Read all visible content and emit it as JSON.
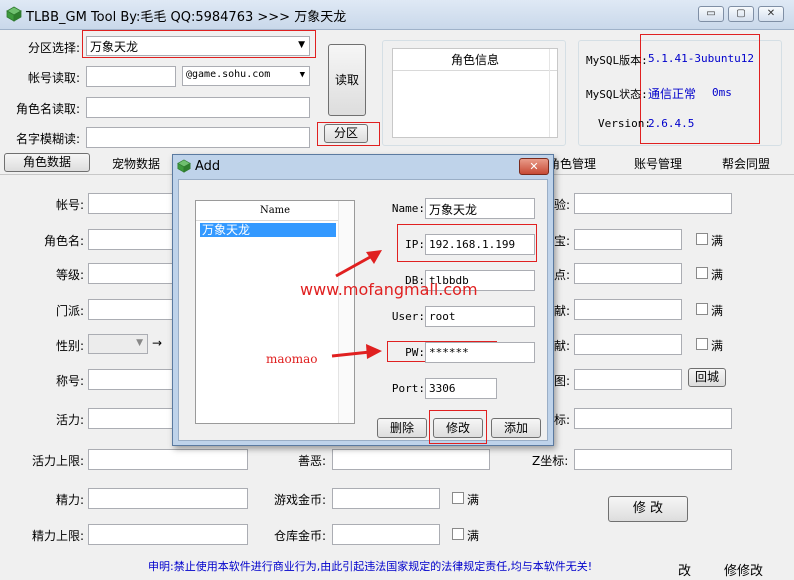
{
  "window": {
    "title": "TLBB_GM Tool By:毛毛 QQ:5984763 >>> 万象天龙",
    "minimize": "▭",
    "restore": "▢",
    "close": "✕"
  },
  "form": {
    "partition_label": "分区选择:",
    "partition_value": "万象天龙",
    "account_read_label": "帐号读取:",
    "account_read_value": "",
    "domain_value": "@game.sohu.com",
    "role_name_read_label": "角色名读取:",
    "fuzzy_name_label": "名字模糊读:",
    "read_button": "读取",
    "partition_button": "分区"
  },
  "role_info": {
    "header": "角色信息"
  },
  "mysql": {
    "version_label": "MySQL版本:",
    "version_value": "5.1.41-3ubuntu12",
    "status_label": "MySQL状态:",
    "status_value": "通信正常",
    "status_time": "0ms",
    "tool_version_label": "Version:",
    "tool_version_value": "2.6.4.5",
    "status_color": "#0000cc"
  },
  "tabs": {
    "role_data": "角色数据",
    "pet_data": "宠物数据",
    "role_manage": "角色管理",
    "account_manage": "账号管理",
    "guild": "帮会同盟"
  },
  "fields_left": [
    {
      "label": "帐号:"
    },
    {
      "label": "角色名:"
    },
    {
      "label": "等级:"
    },
    {
      "label": "门派:"
    },
    {
      "label": "性别:"
    },
    {
      "label": "称号:"
    },
    {
      "label": "活力:"
    },
    {
      "label": "活力上限:"
    },
    {
      "label": "精力:"
    },
    {
      "label": "精力上限:"
    }
  ],
  "fields_mid": {
    "good_evil": "善恶:",
    "game_gold": "游戏金币:",
    "bank_gold": "仓库金币:",
    "full": "满",
    "arrow": "→"
  },
  "fields_right": {
    "experience": "验:",
    "gems": "宝:",
    "points": "点:",
    "contribution": "献:",
    "contribution2": "献:",
    "map": "图:",
    "coord": "标:",
    "z_coord": "Z坐标:",
    "return_city": "回城",
    "full": "满",
    "modify_button": "修 改"
  },
  "footer": {
    "statement": "申明:禁止使用本软件进行商业行为,由此引起违法国家规定的法律规定责任,均与本软件无关!",
    "modify1": "改",
    "modify2": "修修改",
    "statement_color": "#0000cc"
  },
  "dialog": {
    "title": "Add",
    "list_header": "Name",
    "list_items": [
      "万象天龙"
    ],
    "name_label": "Name:",
    "name_value": "万象天龙",
    "ip_label": "IP:",
    "ip_value": "192.168.1.199",
    "db_label": "DB:",
    "db_value": "tlbbdb",
    "user_label": "User:",
    "user_value": "root",
    "pw_label": "PW:",
    "pw_value": "******",
    "port_label": "Port:",
    "port_value": "3306",
    "delete_button": "删除",
    "modify_button": "修改",
    "add_button": "添加",
    "close": "✕"
  },
  "watermarks": {
    "site": "www.mofangmall.com",
    "author": "maomao",
    "color": "#e02020"
  }
}
